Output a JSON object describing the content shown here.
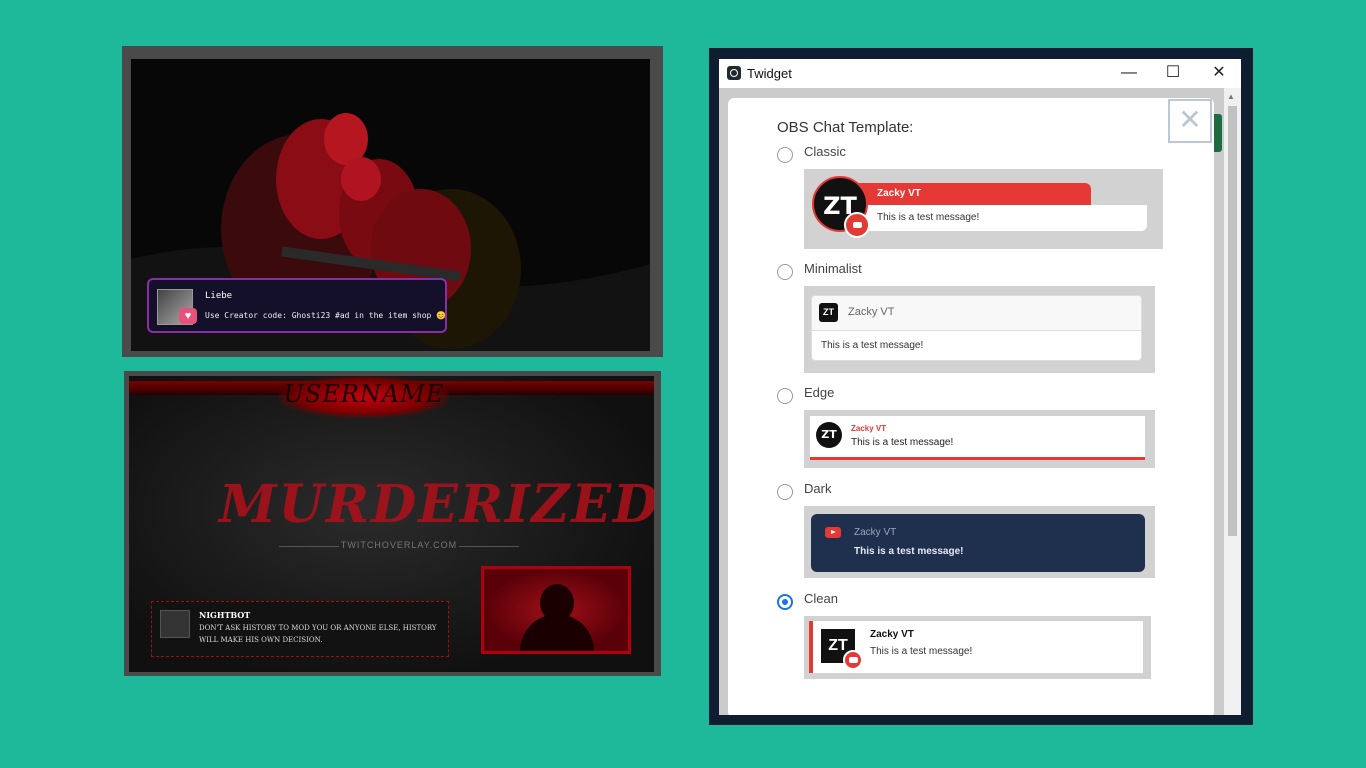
{
  "background_color": "#1db99a",
  "overlay1": {
    "chat_name": "Liebe",
    "chat_message": "Use Creator code: Ghosti23 #ad in the item shop 😊"
  },
  "overlay2": {
    "banner_text": "USERNAME",
    "title_text": "MURDERIZED",
    "site_text": "TWITCHOVERLAY.COM",
    "chat_name": "NIGHTBOT",
    "chat_message": "DON'T ASK HISTORY TO MOD YOU OR ANYONE ELSE, HISTORY WILL MAKE HIS OWN DECISION."
  },
  "window": {
    "title": "Twidget",
    "minimize_label": "—",
    "maximize_label": "☐",
    "close_label": "✕",
    "dialog_close_label": "✕",
    "heading": "OBS Chat Template:",
    "options": [
      {
        "label": "Classic",
        "selected": false
      },
      {
        "label": "Minimalist",
        "selected": false
      },
      {
        "label": "Edge",
        "selected": false
      },
      {
        "label": "Dark",
        "selected": false
      },
      {
        "label": "Clean",
        "selected": true
      }
    ],
    "preview": {
      "avatar_text": "ZT",
      "username": "Zacky VT",
      "message": "This is a test message!"
    }
  }
}
